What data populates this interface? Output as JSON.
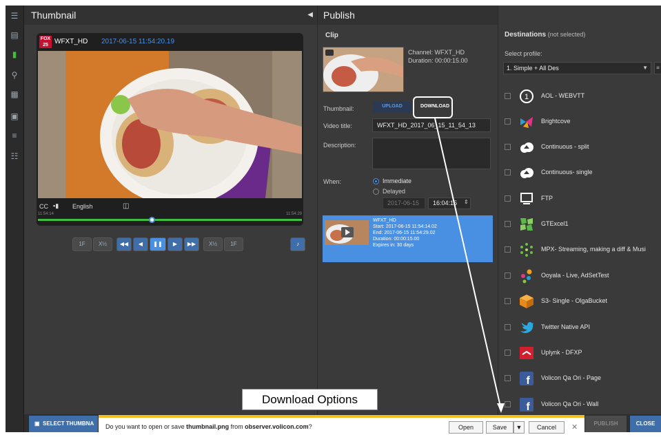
{
  "left_panel": {
    "title": "Thumbnail",
    "collapse_icon": "caret-left-icon",
    "player": {
      "logo_text": "FOX 25",
      "channel": "WFXT_HD",
      "timestamp": "2017-06-15 11:54:20.19",
      "cc_label": "CC",
      "language": "English",
      "time_start": "11:54:14",
      "time_end": "11:54:29",
      "progress_fraction": 0.44
    },
    "transport": [
      "1F",
      "X½",
      "◀◀",
      "◀",
      "❚❚",
      "▶",
      "▶▶",
      "X½",
      "1F"
    ]
  },
  "sidebar_icons": [
    "menu-icon",
    "film-icon",
    "bookmark-icon",
    "search-icon",
    "grid-icon",
    "export-icon",
    "list-icon",
    "table-icon"
  ],
  "publish_panel": {
    "title": "Publish",
    "clip_label": "Clip",
    "channel_text": "Channel: WFXT_HD",
    "duration_text": "Duration: 00:00:15.00",
    "thumbnail_label": "Thumbnail:",
    "upload_label": "UPLOAD",
    "download_label": "DOWNLOAD",
    "video_title_label": "Video title:",
    "video_title_value": "WFXT_HD_2017_06_15_11_54_13",
    "description_label": "Description:",
    "when_label": "When:",
    "immediate_label": "Immediate",
    "delayed_label": "Delayed",
    "date_value": "2017-06-15",
    "time_value": "16:04:15",
    "scheduled": {
      "name": "WFXT_HD",
      "start": "Start: 2017-06-15 11:54:14.02",
      "end": "End: 2017-06-15 11:54:29.02",
      "duration": "Duration: 00:00:15.00",
      "expires": "Expires in: 30 days"
    }
  },
  "destinations_panel": {
    "title": "Destinations",
    "title_note": "(not selected)",
    "select_profile_label": "Select profile:",
    "selected_profile": "1. Simple + All Des",
    "items": [
      {
        "name": "AOL - WEBVTT",
        "icon": "aol-icon"
      },
      {
        "name": "Brightcove",
        "icon": "brightcove-icon"
      },
      {
        "name": "Continuous - split",
        "icon": "cloud-upload-icon"
      },
      {
        "name": "Continuous- single",
        "icon": "cloud-upload-icon"
      },
      {
        "name": "FTP",
        "icon": "monitor-icon"
      },
      {
        "name": "GTExcel1",
        "icon": "gtexcel-icon"
      },
      {
        "name": "MPX- Streaming, making a diff & Musi",
        "icon": "mpx-icon"
      },
      {
        "name": "Ooyala - Live, AdSetTest",
        "icon": "ooyala-icon"
      },
      {
        "name": "S3- Single - OlgaBucket",
        "icon": "s3-box-icon"
      },
      {
        "name": "Twitter Native API",
        "icon": "twitter-icon"
      },
      {
        "name": "Uplynk - DFXP",
        "icon": "uplynk-icon"
      },
      {
        "name": "Volicon Qa Ori - Page",
        "icon": "facebook-icon"
      },
      {
        "name": "Volicon Qa Ori - Wall",
        "icon": "facebook-icon"
      }
    ]
  },
  "bottom": {
    "select_thumbnail": "SELECT THUMBNA",
    "publish": "PUBLISH",
    "close": "CLOSE"
  },
  "download_bar": {
    "message_pre": "Do you want to open or save ",
    "file_name": "thumbnail.png",
    "message_mid": " from ",
    "site": "observer.volicon.com",
    "message_post": "?",
    "open": "Open",
    "save": "Save",
    "cancel": "Cancel"
  },
  "callout": {
    "text": "Download Options"
  }
}
